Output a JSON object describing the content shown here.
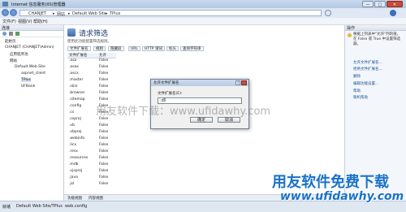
{
  "window": {
    "title": "Internet 信息服务(IIS)管理器",
    "controls": [
      "—",
      "□",
      "✕"
    ]
  },
  "address": {
    "crumbs": [
      "CHANJET",
      "网站",
      "Default Web Site",
      "TPlus"
    ]
  },
  "menu": [
    "文件(F)",
    "视图(V)",
    "帮助(H)"
  ],
  "left_panel": {
    "header": "连接",
    "tree": [
      "起始页",
      "CHANJET (CHANJET\\Admin)",
      "应用程序池",
      "网站",
      "Default Web Site",
      "aspnet_client",
      "TPlus",
      "UFBank"
    ]
  },
  "center": {
    "title": "请求筛选",
    "subtitle": "使用此功能配置筛选规则。",
    "tabs": [
      "文件扩展名",
      "规则",
      "隐藏段",
      "URL",
      "HTTP 谓词",
      "标头",
      "查询字符串"
    ],
    "columns": [
      "文件扩展名",
      "允许"
    ],
    "rows": [
      [
        ".asa",
        "False"
      ],
      [
        ".asax",
        "False"
      ],
      [
        ".ascx",
        "False"
      ],
      [
        ".master",
        "False"
      ],
      [
        ".skin",
        "False"
      ],
      [
        ".browser",
        "False"
      ],
      [
        ".sitemap",
        "False"
      ],
      [
        ".config",
        "False"
      ],
      [
        ".cs",
        "False"
      ],
      [
        ".csproj",
        "False"
      ],
      [
        ".vb",
        "False"
      ],
      [
        ".vbproj",
        "False"
      ],
      [
        ".webinfo",
        "False"
      ],
      [
        ".licx",
        "False"
      ],
      [
        ".resx",
        "False"
      ],
      [
        ".resources",
        "False"
      ],
      [
        ".mdb",
        "False"
      ],
      [
        ".vjsproj",
        "False"
      ],
      [
        ".java",
        "False"
      ],
      [
        ".jsl",
        "False"
      ]
    ],
    "bottom_tabs": [
      "功能视图",
      "内容视图"
    ]
  },
  "right_panel": {
    "header": "操作",
    "note": "根据上列表中\"允许\"列的值，在 False 或 True 中设置筛选器。",
    "links": [
      "允许文件扩展名...",
      "拒绝文件扩展名...",
      "删除",
      "编辑功能设置...",
      "帮助",
      "联机帮助"
    ]
  },
  "dialog": {
    "title": "允许文件扩展名",
    "label": "文件扩展名(E):",
    "value": ".dll",
    "ok": "确定",
    "cancel": "取消",
    "close": "?"
  },
  "status": {
    "left": "就绪",
    "path": "Default Web Site/TPlus",
    "file": "web.config"
  },
  "watermark": {
    "center": "用友软件下载：www.ufidawhy.com",
    "brand": "用友软件免费下载",
    "url": "www.ufidawhy.com"
  }
}
